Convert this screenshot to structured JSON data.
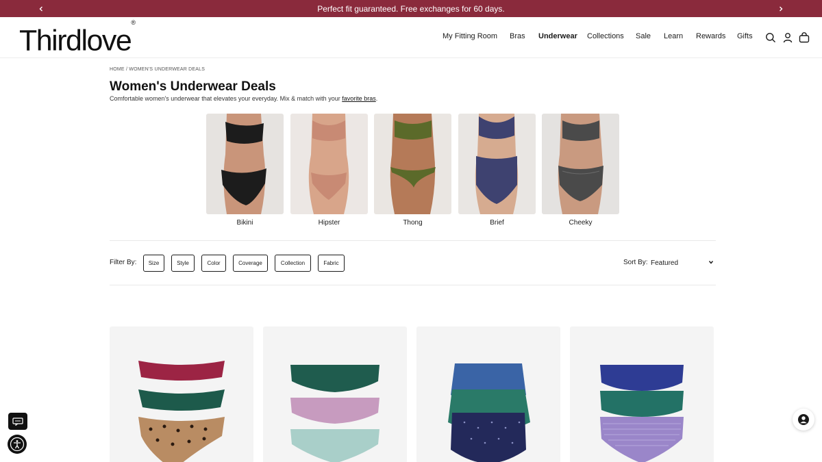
{
  "announcement": {
    "text": "Perfect fit guaranteed. Free exchanges for 60 days.",
    "prev_icon": "chevron-left-icon",
    "next_icon": "chevron-right-icon",
    "background": "#8a2a3c"
  },
  "header": {
    "logo": "Thirdlove",
    "logo_mark": "®",
    "nav": [
      {
        "label": "My Fitting Room",
        "active": false
      },
      {
        "label": "Bras",
        "active": false
      },
      {
        "label": "Underwear",
        "active": true
      },
      {
        "label": "Collections",
        "active": false
      },
      {
        "label": "Sale",
        "active": false
      },
      {
        "label": "Learn",
        "active": false
      },
      {
        "label": "Rewards",
        "active": false
      },
      {
        "label": "Gifts",
        "active": false
      }
    ],
    "icons": [
      "search-icon",
      "account-icon",
      "cart-icon"
    ]
  },
  "breadcrumb": {
    "home": "HOME",
    "separator": "/",
    "current": "WOMEN'S UNDERWEAR DEALS"
  },
  "page": {
    "title": "Women's Underwear Deals",
    "subtitle_prefix": "Comfortable women's underwear that elevates your everyday. Mix & match with your",
    "subtitle_link": "favorite bras",
    "subtitle_suffix": "."
  },
  "styles": [
    {
      "label": "Bikini",
      "color": "#1c1c1c",
      "skin": "#c9957a"
    },
    {
      "label": "Hipster",
      "color": "#c88a74",
      "skin": "#d8a58a"
    },
    {
      "label": "Thong",
      "color": "#5b6a2a",
      "skin": "#b57a58"
    },
    {
      "label": "Brief",
      "color": "#3e4270",
      "skin": "#d6ab90"
    },
    {
      "label": "Cheeky",
      "color": "#4a4a4a",
      "skin": "#c99a80"
    }
  ],
  "filters": {
    "label": "Filter By:",
    "options": [
      "Size",
      "Style",
      "Color",
      "Coverage",
      "Collection",
      "Fabric"
    ]
  },
  "sort": {
    "label": "Sort By:",
    "selected": "Featured"
  },
  "products": [
    {
      "colors": [
        "#9c2444",
        "#1d5a4b",
        "#b98c63"
      ]
    },
    {
      "colors": [
        "#1f5c4e",
        "#c79bbf",
        "#a9cfc9"
      ]
    },
    {
      "colors": [
        "#3a64a6",
        "#2a7a68",
        "#23295a"
      ]
    },
    {
      "colors": [
        "#2e3c94",
        "#237266",
        "#9a86c9"
      ]
    }
  ],
  "floating": {
    "chat_icon": "chat-icon",
    "accessibility_icon": "accessibility-icon",
    "support_icon": "support-agent-icon"
  }
}
